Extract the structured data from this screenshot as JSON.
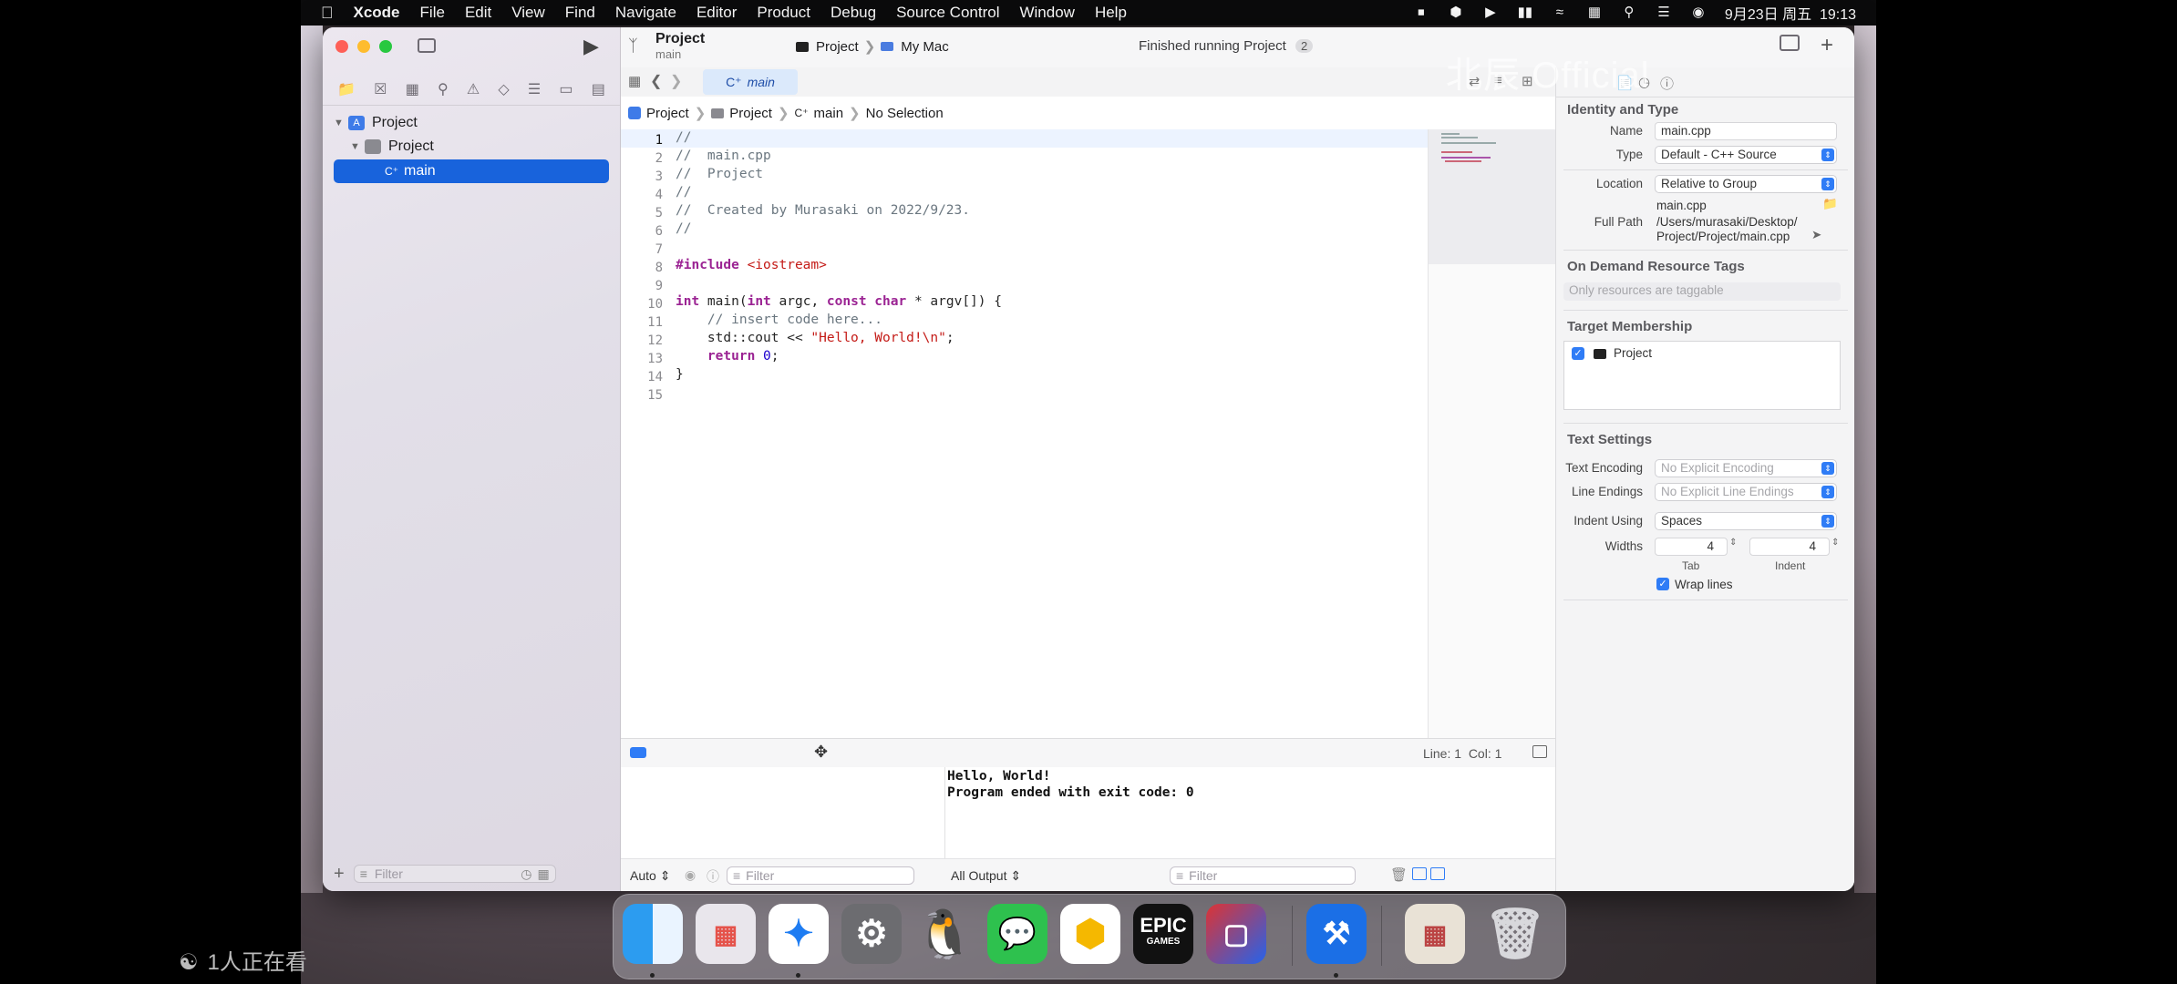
{
  "menubar": {
    "apple": "",
    "app": "Xcode",
    "items": [
      "File",
      "Edit",
      "View",
      "Find",
      "Navigate",
      "Editor",
      "Product",
      "Debug",
      "Source Control",
      "Window",
      "Help"
    ],
    "datetime": "9月23日 周五  19:13"
  },
  "toolbar": {
    "project_title": "Project",
    "project_branch": "main",
    "scheme": "Project",
    "destination": "My Mac",
    "status": "Finished running Project",
    "status_count": "2"
  },
  "navigator": {
    "root": "Project",
    "group": "Project",
    "file": "main",
    "filter_placeholder": "Filter"
  },
  "tab": {
    "label": "main"
  },
  "jumpbar": {
    "items": [
      "Project",
      "Project",
      "main",
      "No Selection"
    ]
  },
  "editor": {
    "line_numbers": [
      "1",
      "2",
      "3",
      "4",
      "5",
      "6",
      "7",
      "8",
      "9",
      "10",
      "11",
      "12",
      "13",
      "14",
      "15"
    ]
  },
  "debug": {
    "cursor": "Line: 1  Col: 1",
    "console_lines": [
      "Hello, World!",
      "Program ended with exit code: 0"
    ],
    "auto_label": "Auto",
    "filter_placeholder": "Filter",
    "output_label": "All Output",
    "filter_placeholder2": "Filter"
  },
  "inspector": {
    "identity_title": "Identity and Type",
    "name_label": "Name",
    "name_value": "main.cpp",
    "type_label": "Type",
    "type_value": "Default - C++ Source",
    "location_label": "Location",
    "location_value": "Relative to Group",
    "location_file": "main.cpp",
    "fullpath_label": "Full Path",
    "fullpath_line1": "/Users/murasaki/Desktop/",
    "fullpath_line2": "Project/Project/main.cpp",
    "odr_title": "On Demand Resource Tags",
    "odr_placeholder": "Only resources are taggable",
    "membership_title": "Target Membership",
    "membership_target": "Project",
    "text_title": "Text Settings",
    "encoding_label": "Text Encoding",
    "encoding_value": "No Explicit Encoding",
    "endings_label": "Line Endings",
    "endings_value": "No Explicit Line Endings",
    "indent_label": "Indent Using",
    "indent_value": "Spaces",
    "widths_label": "Widths",
    "tab_width": "4",
    "indent_width": "4",
    "tab_caption": "Tab",
    "indent_caption": "Indent",
    "wrap_label": "Wrap lines"
  },
  "overlay": {
    "watermark": "北辰 Official",
    "viewers": "1人正在看"
  },
  "dock": {
    "epic_line1": "EPIC",
    "epic_line2": "GAMES"
  }
}
